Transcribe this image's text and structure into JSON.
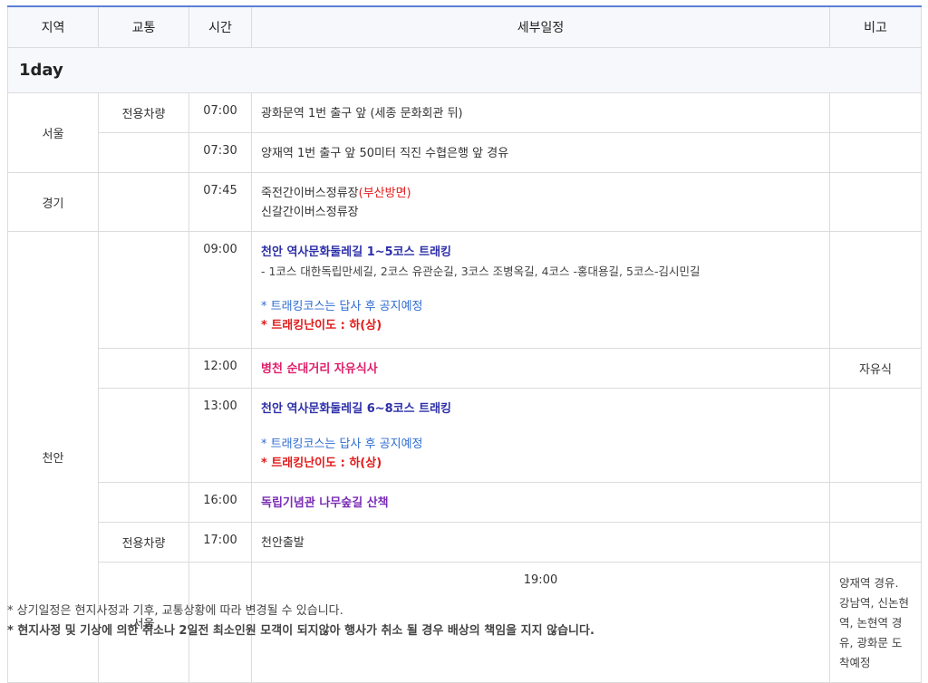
{
  "headers": [
    "지역",
    "교통",
    "시간",
    "세부일정",
    "비고"
  ],
  "day_label": "1day",
  "regions": [
    "서울",
    "경기",
    "천안",
    "서울"
  ],
  "transport": [
    "전용차량",
    "전용차량"
  ],
  "rows": [
    {
      "time": "07:00",
      "lines": [
        "광화문역 1번 출구 앞 (세종 문화회관 뒤)"
      ]
    },
    {
      "time": "07:30",
      "lines": [
        "양재역 1번 출구 앞 50미터 직진 수협은행 앞 경유"
      ]
    },
    {
      "time": "07:45",
      "line1_main": "죽전간이버스정류장",
      "line1_red": "(부산방면)",
      "line2": "신갈간이버스정류장"
    },
    {
      "time": "09:00",
      "title": "천안 역사문화둘레길 1~5코스 트래킹",
      "sub": "- 1코스 대한독립만세길, 2코스 유관순길, 3코스 조병옥길, 4코스 -홍대용길, 5코스-김시민길",
      "note": "* 트래킹코스는 답사 후 공지예정",
      "diff": "* 트래킹난이도 : 하(상)"
    },
    {
      "time": "12:00",
      "title": "병천 순대거리 자유식사",
      "remark": "자유식"
    },
    {
      "time": "13:00",
      "title": "천안 역사문화둘레길 6~8코스 트래킹",
      "note": "* 트래킹코스는 답사 후 공지예정",
      "diff": "* 트래킹난이도 : 하(상)"
    },
    {
      "time": "16:00",
      "title": "독립기념관 나무숲길 산책"
    },
    {
      "time": "17:00",
      "lines": [
        "천안출발"
      ]
    },
    {
      "time": "19:00",
      "lines": [
        "양재역 경유. 강남역, 신논현역, 논현역 경유, 광화문 도착예정"
      ]
    }
  ],
  "footnotes": [
    "* 상기일정은 현지사정과 기후, 교통상황에 따라 변경될 수 있습니다.",
    "* 현지사정 및 기상에 의한 취소나 2일전 최소인원 모객이 되지않아 행사가 취소 될 경우 배상의 책임을 지지 않습니다."
  ]
}
